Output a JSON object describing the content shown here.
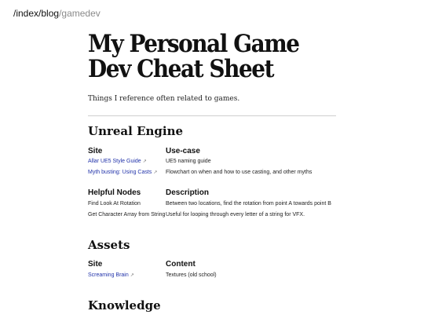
{
  "breadcrumb": {
    "index": "/index",
    "blog": "/blog",
    "current": "/gamedev"
  },
  "page": {
    "title_line1": "My Personal Game",
    "title_line2": "Dev Cheat Sheet",
    "subtitle": "Things I reference often related to games."
  },
  "sections": {
    "unreal": {
      "heading": "Unreal Engine",
      "sites_table": {
        "headers": [
          "Site",
          "Use-case"
        ],
        "rows": [
          [
            "Allar UE5 Style Guide",
            "UE5 naming guide"
          ],
          [
            "Myth busting: Using Casts",
            "Flowchart on when and how to use casting, and other myths"
          ]
        ]
      },
      "nodes_table": {
        "headers": [
          "Helpful Nodes",
          "Description"
        ],
        "rows": [
          [
            "Find Look At Rotation",
            "Between two locations, find the rotation from point A towards point B"
          ],
          [
            "Get Character Array from String",
            "Useful for looping through every letter of a string for VFX."
          ]
        ]
      }
    },
    "assets": {
      "heading": "Assets",
      "table": {
        "headers": [
          "Site",
          "Content"
        ],
        "rows": [
          [
            "Screaming Brain",
            "Textures (old school)"
          ]
        ]
      }
    },
    "knowledge": {
      "heading": "Knowledge"
    }
  },
  "icons": {
    "external_link": "external-link-icon",
    "external_link_glyph": "↗"
  },
  "colors": {
    "link": "#2233aa",
    "breadcrumb_current": "#8a8a8a",
    "divider": "#cfcfcf"
  }
}
